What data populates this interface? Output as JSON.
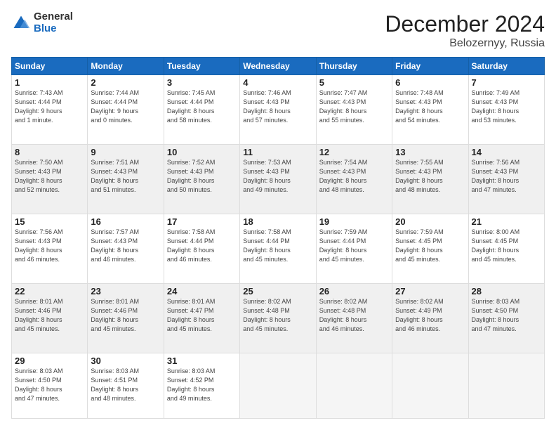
{
  "logo": {
    "general": "General",
    "blue": "Blue"
  },
  "header": {
    "month": "December 2024",
    "location": "Belozernyy, Russia"
  },
  "weekdays": [
    "Sunday",
    "Monday",
    "Tuesday",
    "Wednesday",
    "Thursday",
    "Friday",
    "Saturday"
  ],
  "weeks": [
    [
      {
        "day": "1",
        "info": "Sunrise: 7:43 AM\nSunset: 4:44 PM\nDaylight: 9 hours\nand 1 minute."
      },
      {
        "day": "2",
        "info": "Sunrise: 7:44 AM\nSunset: 4:44 PM\nDaylight: 9 hours\nand 0 minutes."
      },
      {
        "day": "3",
        "info": "Sunrise: 7:45 AM\nSunset: 4:44 PM\nDaylight: 8 hours\nand 58 minutes."
      },
      {
        "day": "4",
        "info": "Sunrise: 7:46 AM\nSunset: 4:43 PM\nDaylight: 8 hours\nand 57 minutes."
      },
      {
        "day": "5",
        "info": "Sunrise: 7:47 AM\nSunset: 4:43 PM\nDaylight: 8 hours\nand 55 minutes."
      },
      {
        "day": "6",
        "info": "Sunrise: 7:48 AM\nSunset: 4:43 PM\nDaylight: 8 hours\nand 54 minutes."
      },
      {
        "day": "7",
        "info": "Sunrise: 7:49 AM\nSunset: 4:43 PM\nDaylight: 8 hours\nand 53 minutes."
      }
    ],
    [
      {
        "day": "8",
        "info": "Sunrise: 7:50 AM\nSunset: 4:43 PM\nDaylight: 8 hours\nand 52 minutes."
      },
      {
        "day": "9",
        "info": "Sunrise: 7:51 AM\nSunset: 4:43 PM\nDaylight: 8 hours\nand 51 minutes."
      },
      {
        "day": "10",
        "info": "Sunrise: 7:52 AM\nSunset: 4:43 PM\nDaylight: 8 hours\nand 50 minutes."
      },
      {
        "day": "11",
        "info": "Sunrise: 7:53 AM\nSunset: 4:43 PM\nDaylight: 8 hours\nand 49 minutes."
      },
      {
        "day": "12",
        "info": "Sunrise: 7:54 AM\nSunset: 4:43 PM\nDaylight: 8 hours\nand 48 minutes."
      },
      {
        "day": "13",
        "info": "Sunrise: 7:55 AM\nSunset: 4:43 PM\nDaylight: 8 hours\nand 48 minutes."
      },
      {
        "day": "14",
        "info": "Sunrise: 7:56 AM\nSunset: 4:43 PM\nDaylight: 8 hours\nand 47 minutes."
      }
    ],
    [
      {
        "day": "15",
        "info": "Sunrise: 7:56 AM\nSunset: 4:43 PM\nDaylight: 8 hours\nand 46 minutes."
      },
      {
        "day": "16",
        "info": "Sunrise: 7:57 AM\nSunset: 4:43 PM\nDaylight: 8 hours\nand 46 minutes."
      },
      {
        "day": "17",
        "info": "Sunrise: 7:58 AM\nSunset: 4:44 PM\nDaylight: 8 hours\nand 46 minutes."
      },
      {
        "day": "18",
        "info": "Sunrise: 7:58 AM\nSunset: 4:44 PM\nDaylight: 8 hours\nand 45 minutes."
      },
      {
        "day": "19",
        "info": "Sunrise: 7:59 AM\nSunset: 4:44 PM\nDaylight: 8 hours\nand 45 minutes."
      },
      {
        "day": "20",
        "info": "Sunrise: 7:59 AM\nSunset: 4:45 PM\nDaylight: 8 hours\nand 45 minutes."
      },
      {
        "day": "21",
        "info": "Sunrise: 8:00 AM\nSunset: 4:45 PM\nDaylight: 8 hours\nand 45 minutes."
      }
    ],
    [
      {
        "day": "22",
        "info": "Sunrise: 8:01 AM\nSunset: 4:46 PM\nDaylight: 8 hours\nand 45 minutes."
      },
      {
        "day": "23",
        "info": "Sunrise: 8:01 AM\nSunset: 4:46 PM\nDaylight: 8 hours\nand 45 minutes."
      },
      {
        "day": "24",
        "info": "Sunrise: 8:01 AM\nSunset: 4:47 PM\nDaylight: 8 hours\nand 45 minutes."
      },
      {
        "day": "25",
        "info": "Sunrise: 8:02 AM\nSunset: 4:48 PM\nDaylight: 8 hours\nand 45 minutes."
      },
      {
        "day": "26",
        "info": "Sunrise: 8:02 AM\nSunset: 4:48 PM\nDaylight: 8 hours\nand 46 minutes."
      },
      {
        "day": "27",
        "info": "Sunrise: 8:02 AM\nSunset: 4:49 PM\nDaylight: 8 hours\nand 46 minutes."
      },
      {
        "day": "28",
        "info": "Sunrise: 8:03 AM\nSunset: 4:50 PM\nDaylight: 8 hours\nand 47 minutes."
      }
    ],
    [
      {
        "day": "29",
        "info": "Sunrise: 8:03 AM\nSunset: 4:50 PM\nDaylight: 8 hours\nand 47 minutes."
      },
      {
        "day": "30",
        "info": "Sunrise: 8:03 AM\nSunset: 4:51 PM\nDaylight: 8 hours\nand 48 minutes."
      },
      {
        "day": "31",
        "info": "Sunrise: 8:03 AM\nSunset: 4:52 PM\nDaylight: 8 hours\nand 49 minutes."
      },
      null,
      null,
      null,
      null
    ]
  ]
}
